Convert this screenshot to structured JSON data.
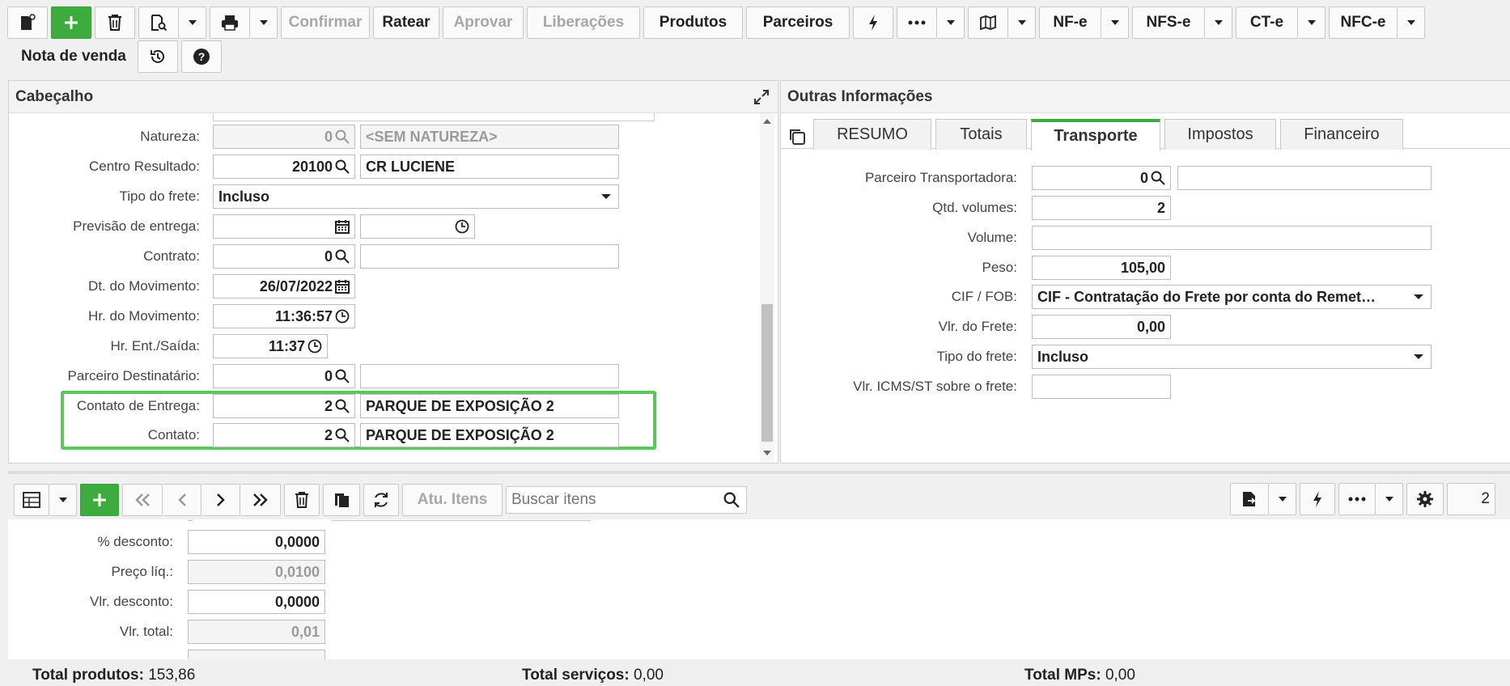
{
  "toolbar": {
    "confirmar": "Confirmar",
    "ratear": "Ratear",
    "aprovar": "Aprovar",
    "liberacoes": "Liberações",
    "produtos": "Produtos",
    "parceiros": "Parceiros",
    "nfe": "NF-e",
    "nfse": "NFS-e",
    "cte": "CT-e",
    "nfce": "NFC-e"
  },
  "page_title": "Nota de venda",
  "cabecalho": {
    "title": "Cabeçalho",
    "fields": {
      "natureza": {
        "label": "Natureza:",
        "code": "0",
        "desc": "<SEM NATUREZA>"
      },
      "centro": {
        "label": "Centro Resultado:",
        "code": "20100",
        "desc": "CR LUCIENE"
      },
      "tipo_frete": {
        "label": "Tipo do frete:",
        "value": "Incluso"
      },
      "previsao": {
        "label": "Previsão de entrega:",
        "value": ""
      },
      "contrato": {
        "label": "Contrato:",
        "code": "0",
        "desc": ""
      },
      "dt_mov": {
        "label": "Dt. do Movimento:",
        "value": "26/07/2022"
      },
      "hr_mov": {
        "label": "Hr. do Movimento:",
        "value": "11:36:57"
      },
      "hr_ent": {
        "label": "Hr. Ent./Saída:",
        "value": "11:37"
      },
      "parceiro_dest": {
        "label": "Parceiro Destinatário:",
        "code": "0",
        "desc": ""
      },
      "contato_entrega": {
        "label": "Contato de Entrega:",
        "code": "2",
        "desc": "PARQUE DE EXPOSIÇÃO 2"
      },
      "contato": {
        "label": "Contato:",
        "code": "2",
        "desc": "PARQUE DE EXPOSIÇÃO 2"
      }
    }
  },
  "outras": {
    "title": "Outras Informações",
    "tabs": [
      "RESUMO",
      "Totais",
      "Transporte",
      "Impostos",
      "Financeiro"
    ],
    "active_tab": "Transporte",
    "fields": {
      "parceiro_transp": {
        "label": "Parceiro Transportadora:",
        "code": "0",
        "desc": ""
      },
      "qtd_volumes": {
        "label": "Qtd. volumes:",
        "value": "2"
      },
      "volume": {
        "label": "Volume:",
        "value": ""
      },
      "peso": {
        "label": "Peso:",
        "value": "105,00"
      },
      "cif_fob": {
        "label": "CIF / FOB:",
        "value": "CIF - Contratação do Frete por conta do Remet…"
      },
      "vlr_frete": {
        "label": "Vlr. do Frete:",
        "value": "0,00"
      },
      "tipo_frete": {
        "label": "Tipo do frete:",
        "value": "Incluso"
      },
      "vlr_icms": {
        "label": "Vlr. ICMS/ST sobre o frete:",
        "value": ""
      }
    }
  },
  "itens": {
    "atu_itens": "Atu. Itens",
    "search_placeholder": "Buscar itens",
    "page": "2",
    "fields": {
      "desconto_pct": {
        "label": "% desconto:",
        "value": "0,0000"
      },
      "preco_liq": {
        "label": "Preço líq.:",
        "value": "0,0100"
      },
      "vlr_desconto": {
        "label": "Vlr. desconto:",
        "value": "0,0000"
      },
      "vlr_total": {
        "label": "Vlr. total:",
        "value": "0,01"
      }
    }
  },
  "footer": {
    "total_produtos_label": "Total produtos:",
    "total_produtos": "153,86",
    "total_servicos_label": "Total serviços:",
    "total_servicos": "0,00",
    "total_mps_label": "Total MPs:",
    "total_mps": "0,00"
  },
  "colors": {
    "accent": "#3dab3d",
    "highlight": "#5cc85c"
  }
}
